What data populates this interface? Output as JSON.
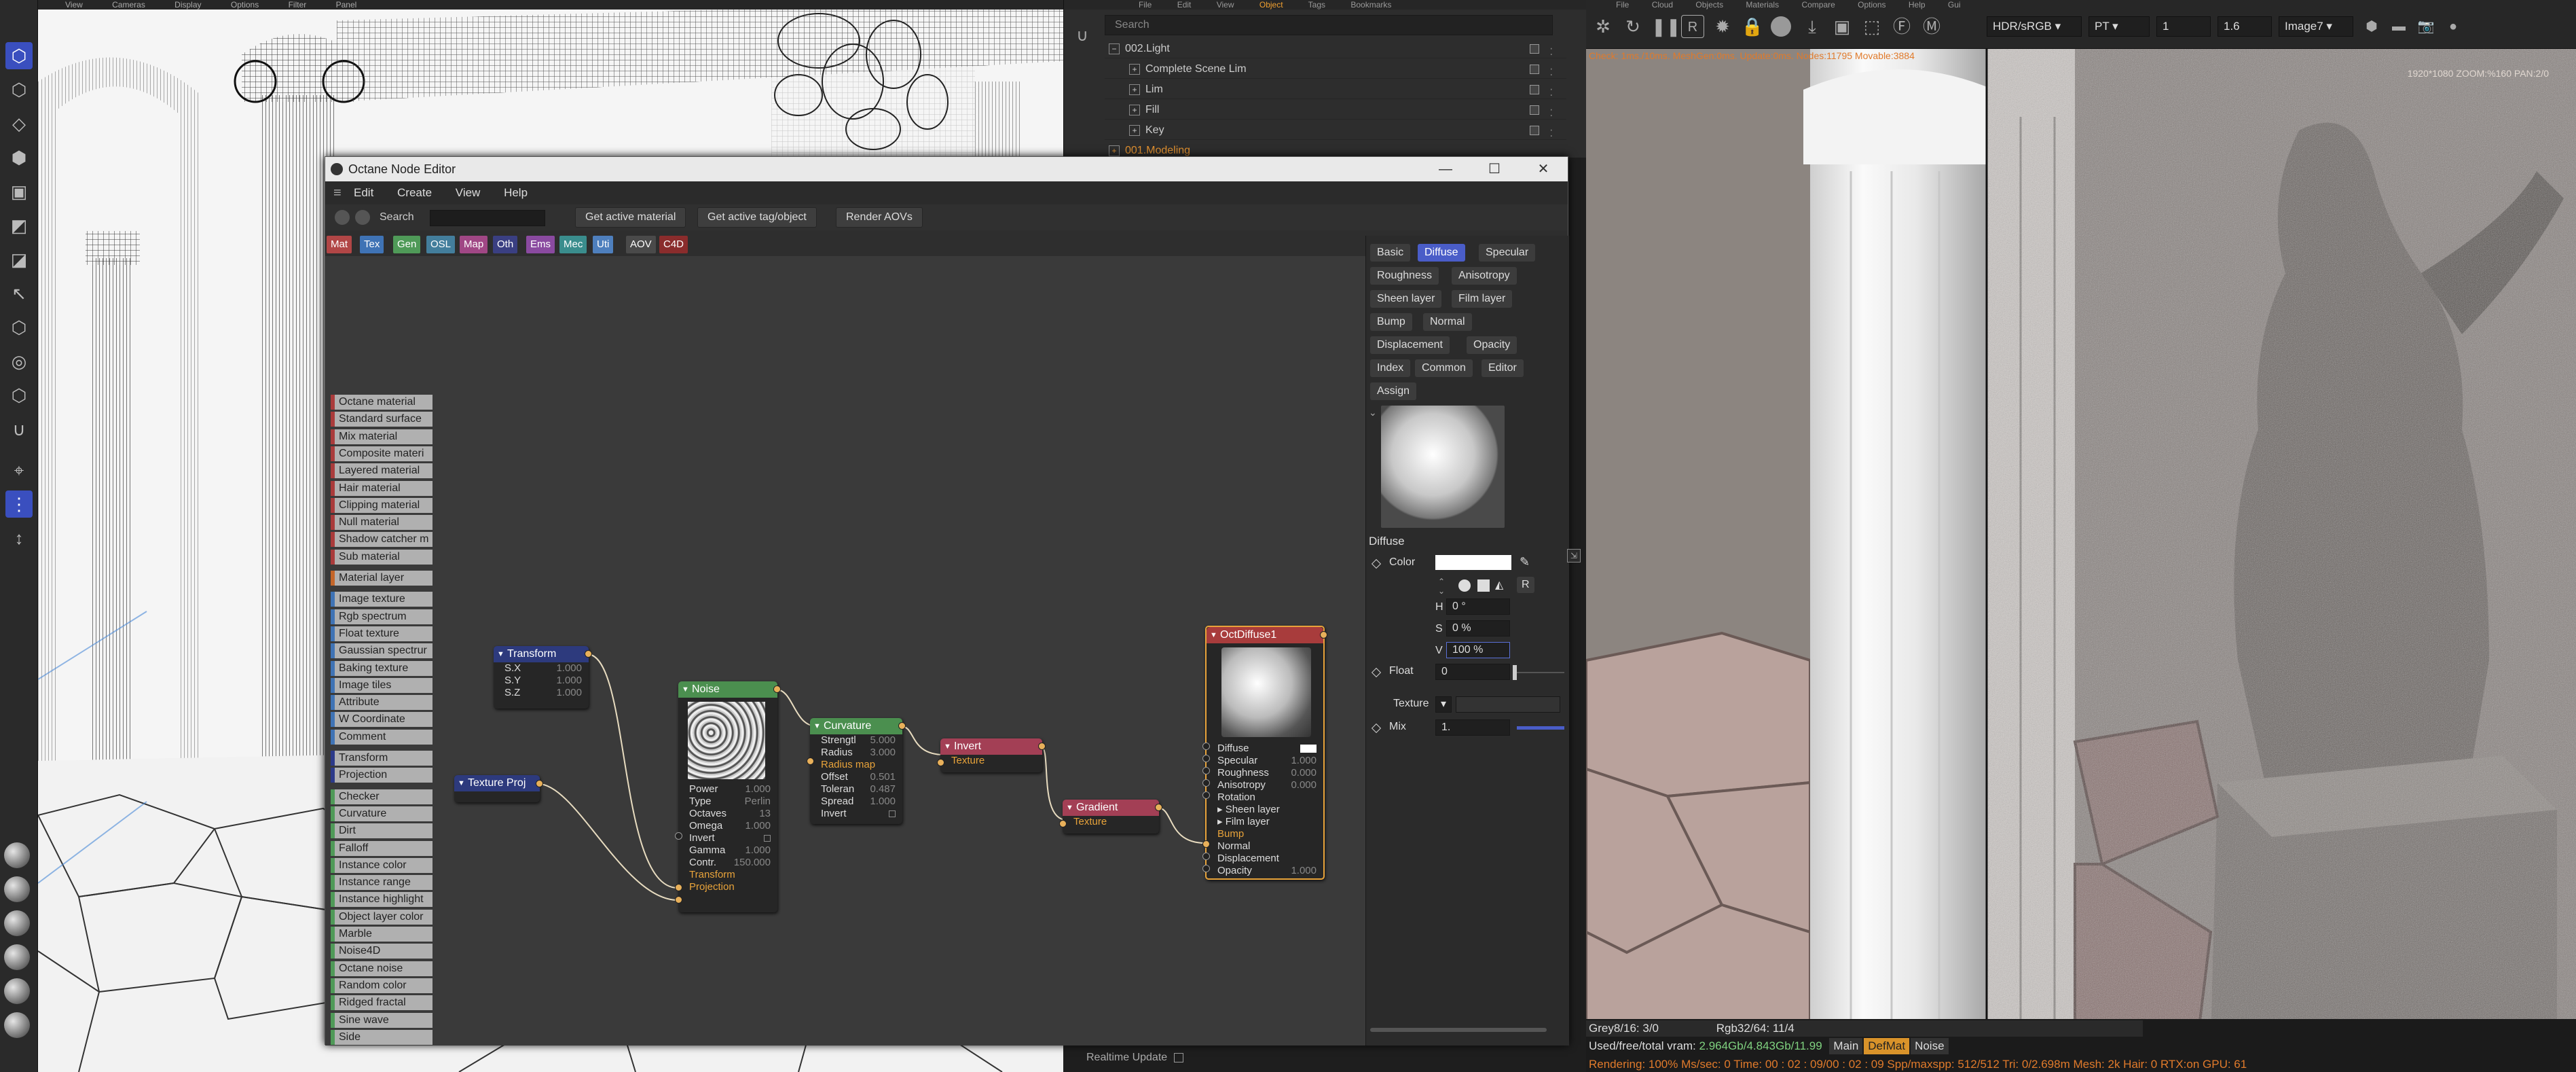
{
  "node_editor": {
    "title": "Octane Node Editor",
    "menu": [
      "Edit",
      "Create",
      "View",
      "Help"
    ],
    "search_label": "Search",
    "buttons": {
      "get_active_material": "Get active material",
      "get_active_tag": "Get active tag/object",
      "render_aovs": "Render AOVs"
    },
    "categories": [
      {
        "label": "Mat",
        "color": "#b14646"
      },
      {
        "label": "Tex",
        "color": "#3f73b5"
      },
      {
        "label": "Gen",
        "color": "#4f9a58"
      },
      {
        "label": "OSL",
        "color": "#437e9c"
      },
      {
        "label": "Map",
        "color": "#a04785"
      },
      {
        "label": "Oth",
        "color": "#3a3f82"
      },
      {
        "label": "Ems",
        "color": "#8a4aa0"
      },
      {
        "label": "Mec",
        "color": "#3a8d8d"
      },
      {
        "label": "Uti",
        "color": "#4e7fbd"
      },
      {
        "label": "AOV",
        "color": "#4a4a4a"
      },
      {
        "label": "C4D",
        "color": "#8a2c2c"
      }
    ],
    "palette": [
      {
        "label": "Octane material",
        "color": "#aa3b3b"
      },
      {
        "label": "Standard surface",
        "color": "#aa3b3b"
      },
      {
        "label": "Mix material",
        "color": "#aa3b3b"
      },
      {
        "label": "Composite materi",
        "color": "#aa3b3b"
      },
      {
        "label": "Layered material",
        "color": "#aa3b3b"
      },
      {
        "label": "Hair material",
        "color": "#aa3b3b"
      },
      {
        "label": "Clipping material",
        "color": "#aa3b3b"
      },
      {
        "label": "Null material",
        "color": "#aa3b3b"
      },
      {
        "label": "Shadow catcher m",
        "color": "#aa3b3b"
      },
      {
        "label": "Sub material",
        "color": "#aa3b3b"
      },
      {
        "label": "Material layer",
        "color": "#c4662a"
      },
      {
        "label": "Image texture",
        "color": "#3f73b5"
      },
      {
        "label": "Rgb spectrum",
        "color": "#3f73b5"
      },
      {
        "label": "Float texture",
        "color": "#3f73b5"
      },
      {
        "label": "Gaussian spectrur",
        "color": "#3f73b5"
      },
      {
        "label": "Baking texture",
        "color": "#3f73b5"
      },
      {
        "label": "Image tiles",
        "color": "#3f73b5"
      },
      {
        "label": "Attribute",
        "color": "#3f73b5"
      },
      {
        "label": "W Coordinate",
        "color": "#3f73b5"
      },
      {
        "label": "Comment",
        "color": "#3f73b5"
      },
      {
        "label": "Transform",
        "color": "#2c3a8a"
      },
      {
        "label": "Projection",
        "color": "#2c3a8a"
      },
      {
        "label": "Checker",
        "color": "#4f9a58"
      },
      {
        "label": "Curvature",
        "color": "#4f9a58"
      },
      {
        "label": "Dirt",
        "color": "#4f9a58"
      },
      {
        "label": "Falloff",
        "color": "#4f9a58"
      },
      {
        "label": "Instance color",
        "color": "#4f9a58"
      },
      {
        "label": "Instance range",
        "color": "#4f9a58"
      },
      {
        "label": "Instance highlight",
        "color": "#4f9a58"
      },
      {
        "label": "Object layer color",
        "color": "#4f9a58"
      },
      {
        "label": "Marble",
        "color": "#4f9a58"
      },
      {
        "label": "Noise4D",
        "color": "#4f9a58"
      },
      {
        "label": "Octane noise",
        "color": "#4f9a58"
      },
      {
        "label": "Random color",
        "color": "#4f9a58"
      },
      {
        "label": "Ridged fractal",
        "color": "#4f9a58"
      },
      {
        "label": "Sine wave",
        "color": "#4f9a58"
      },
      {
        "label": "Side",
        "color": "#4f9a58"
      }
    ],
    "nodes": {
      "transform": {
        "title": "Transform",
        "params": [
          {
            "k": "S.X",
            "v": "1.000"
          },
          {
            "k": "S.Y",
            "v": "1.000"
          },
          {
            "k": "S.Z",
            "v": "1.000"
          }
        ]
      },
      "texture_proj": {
        "title": "Texture Proj"
      },
      "noise": {
        "title": "Noise",
        "params": [
          {
            "k": "Power",
            "v": "1.000"
          },
          {
            "k": "Type",
            "v": "Perlin"
          },
          {
            "k": "Octaves",
            "v": "13"
          },
          {
            "k": "Omega",
            "v": "1.000"
          },
          {
            "k": "Invert",
            "v": ""
          },
          {
            "k": "Gamma",
            "v": "1.000"
          },
          {
            "k": "Contr.",
            "v": "150.000"
          }
        ],
        "inputs": [
          "Transform",
          "Projection"
        ]
      },
      "curvature": {
        "title": "Curvature",
        "params": [
          {
            "k": "Strengtl",
            "v": "5.000"
          },
          {
            "k": "Radius",
            "v": "3.000"
          },
          {
            "k": "Radius map",
            "v": ""
          },
          {
            "k": "Offset",
            "v": "0.501"
          },
          {
            "k": "Toleran",
            "v": "0.487"
          },
          {
            "k": "Spread",
            "v": "1.000"
          },
          {
            "k": "Invert",
            "v": ""
          }
        ]
      },
      "invert": {
        "title": "Invert",
        "input": "Texture"
      },
      "gradient": {
        "title": "Gradient",
        "input": "Texture"
      },
      "diffuse": {
        "title": "OctDiffuse1",
        "params": [
          {
            "k": "Diffuse",
            "v": ""
          },
          {
            "k": "Specular",
            "v": "1.000"
          },
          {
            "k": "Roughness",
            "v": "0.000"
          },
          {
            "k": "Anisotropy",
            "v": "0.000"
          },
          {
            "k": "Rotation",
            "v": ""
          },
          {
            "k": "▸ Sheen layer",
            "v": ""
          },
          {
            "k": "▸ Film layer",
            "v": ""
          },
          {
            "k": "Bump",
            "v": ""
          },
          {
            "k": "Normal",
            "v": ""
          },
          {
            "k": "Displacement",
            "v": ""
          },
          {
            "k": "Opacity",
            "v": "1.000"
          }
        ]
      }
    },
    "panel": {
      "tabs": [
        "Basic",
        "Diffuse",
        "Specular",
        "Roughness",
        "Anisotropy",
        "Sheen layer",
        "Film layer",
        "Bump",
        "Normal",
        "Displacement",
        "Opacity",
        "Index",
        "Common",
        "Editor",
        "Assign"
      ],
      "selected_tab": "Diffuse",
      "section_title": "Diffuse",
      "color_label": "Color",
      "r_label": "R",
      "h_label": "H",
      "h_value": "0 °",
      "s_label": "S",
      "s_value": "0 %",
      "v_label": "V",
      "v_value": "100 %",
      "float_label": "Float",
      "float_value": "0",
      "texture_label": "Texture",
      "mix_label": "Mix",
      "mix_value": "1."
    }
  },
  "object_manager": {
    "menu": [
      "File",
      "Edit",
      "View",
      "Object",
      "Tags",
      "Bookmarks"
    ],
    "selected_menu": "Object",
    "search_placeholder": "Search",
    "rows": [
      "002.Light",
      "Complete Scene Lim",
      "Lim",
      "Fill",
      "Key",
      "001.Modeling"
    ],
    "realtime_label": "Realtime Update"
  },
  "render_viewer": {
    "menu": [
      "File",
      "Cloud",
      "Objects",
      "Materials",
      "Compare",
      "Options",
      "Help",
      "Gui"
    ],
    "color_space": "HDR/sRGB",
    "kernel": "PT",
    "spinner_1": "1",
    "spinner_2": "1.6",
    "image_mode": "Image7",
    "info_line": "Check: 1ms./10ms. MeshGen:0ms. Update:0ms. Nodes:11795 Movable:3884",
    "zoom_line": "1920*1080 ZOOM:%160 PAN:2/0",
    "status": {
      "grey": "Grey8/16: 3/0",
      "rgb": "Rgb32/64: 11/4",
      "vram_label": "Used/free/total vram:",
      "vram_value": "2.964Gb/4.843Gb/11.99",
      "tabs": [
        "Main",
        "DefMat",
        "Noise"
      ],
      "render_line": "Rendering: 100%  Ms/sec: 0   Time: 00 : 02 : 09/00 : 02 : 09   Spp/maxspp: 512/512   Tri: 0/2.698m   Mesh: 2k   Hair: 0   RTX:on   GPU: 61"
    }
  },
  "c4d_viewport": {
    "menu": [
      "View",
      "Cameras",
      "Display",
      "Options",
      "Filter",
      "Panel"
    ]
  }
}
